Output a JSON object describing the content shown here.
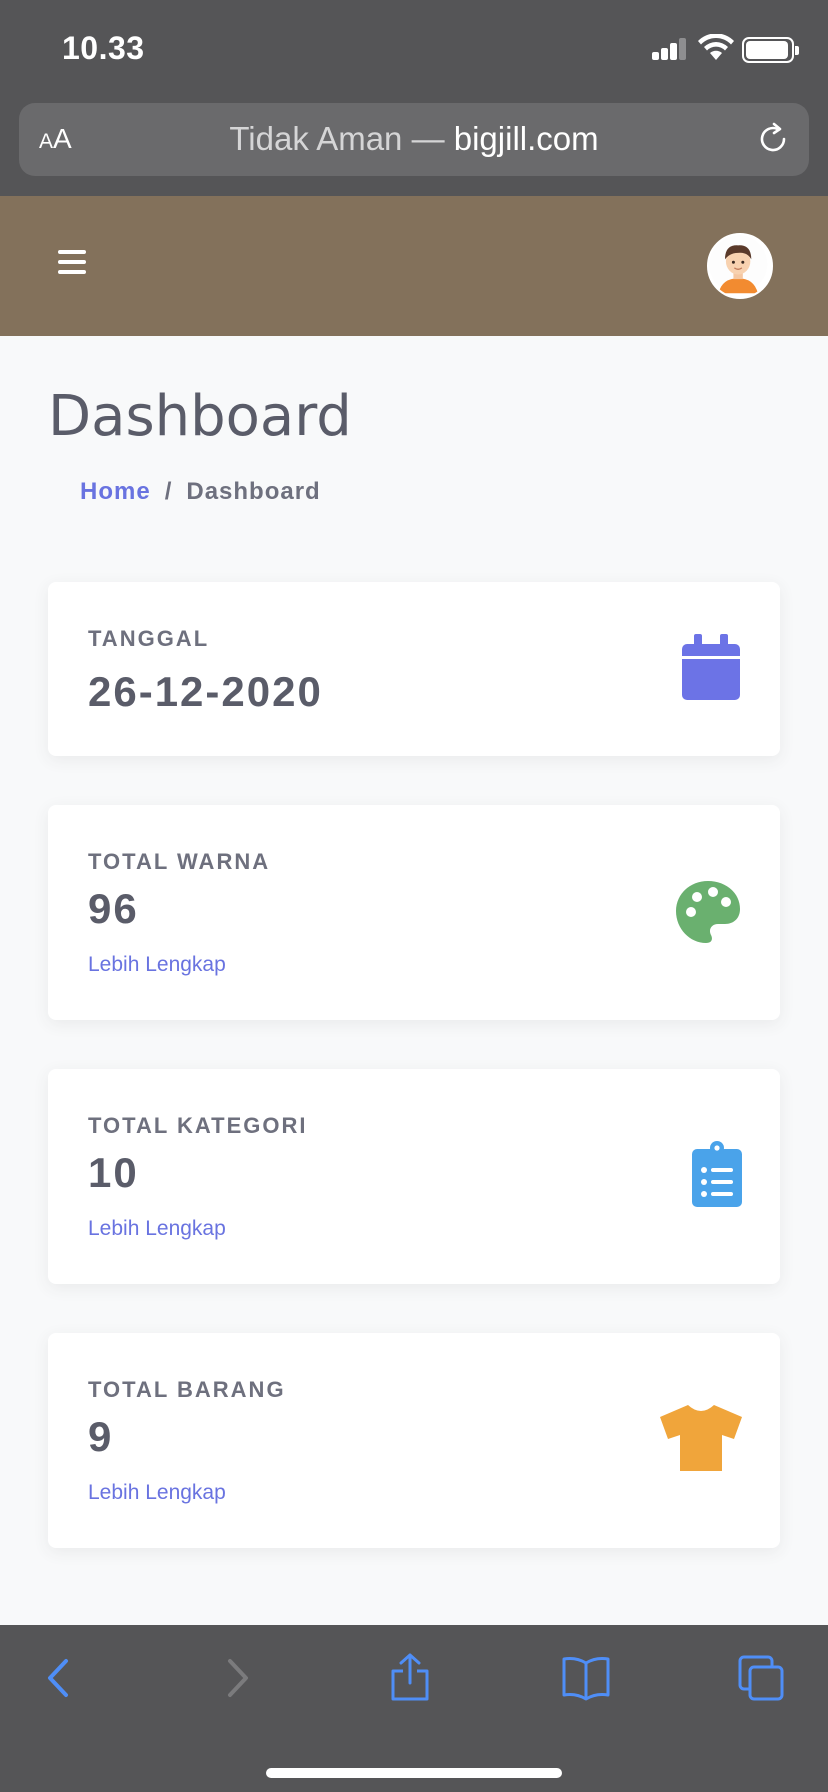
{
  "status_bar": {
    "time": "10.33"
  },
  "browser": {
    "text_size_label": "AA",
    "security_text": "Tidak Aman —",
    "domain": "bigjill.com"
  },
  "header": {
    "menu_icon": "hamburger-icon",
    "avatar_icon": "user-avatar"
  },
  "page": {
    "title": "Dashboard",
    "breadcrumb": {
      "home": "Home",
      "separator": "/",
      "current": "Dashboard"
    }
  },
  "cards": [
    {
      "label": "TANGGAL",
      "value": "26-12-2020",
      "icon": "calendar-icon",
      "icon_color": "#6c73e6"
    },
    {
      "label": "TOTAL WARNA",
      "value": "96",
      "link": "Lebih Lengkap",
      "icon": "palette-icon",
      "icon_color": "#6ab06f"
    },
    {
      "label": "TOTAL KATEGORI",
      "value": "10",
      "link": "Lebih Lengkap",
      "icon": "clipboard-list-icon",
      "icon_color": "#4aa3ea"
    },
    {
      "label": "TOTAL BARANG",
      "value": "9",
      "link": "Lebih Lengkap",
      "icon": "tshirt-icon",
      "icon_color": "#f0a53b"
    }
  ],
  "toolbar": {
    "icons": [
      "back-icon",
      "forward-icon",
      "share-icon",
      "bookmarks-icon",
      "tabs-icon"
    ],
    "accent": "#4f8ef7"
  }
}
